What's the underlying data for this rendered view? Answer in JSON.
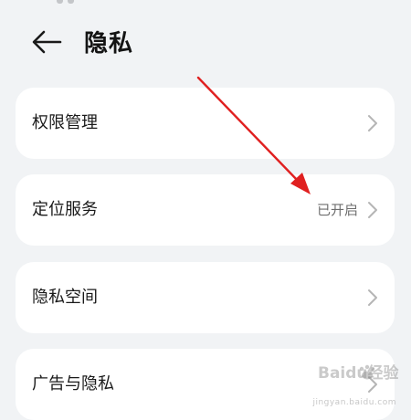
{
  "header": {
    "title": "隐私",
    "back_icon": "arrow-left-icon"
  },
  "items": [
    {
      "label": "权限管理",
      "value": ""
    },
    {
      "label": "定位服务",
      "value": "已开启"
    },
    {
      "label": "隐私空间",
      "value": ""
    },
    {
      "label": "广告与隐私",
      "value": ""
    }
  ],
  "watermark": {
    "logo_text": "Baidu经验",
    "url": "jingyan.baidu.com"
  },
  "colors": {
    "background": "#f1f3f5",
    "card": "#ffffff",
    "annotation_arrow": "#e02020"
  }
}
